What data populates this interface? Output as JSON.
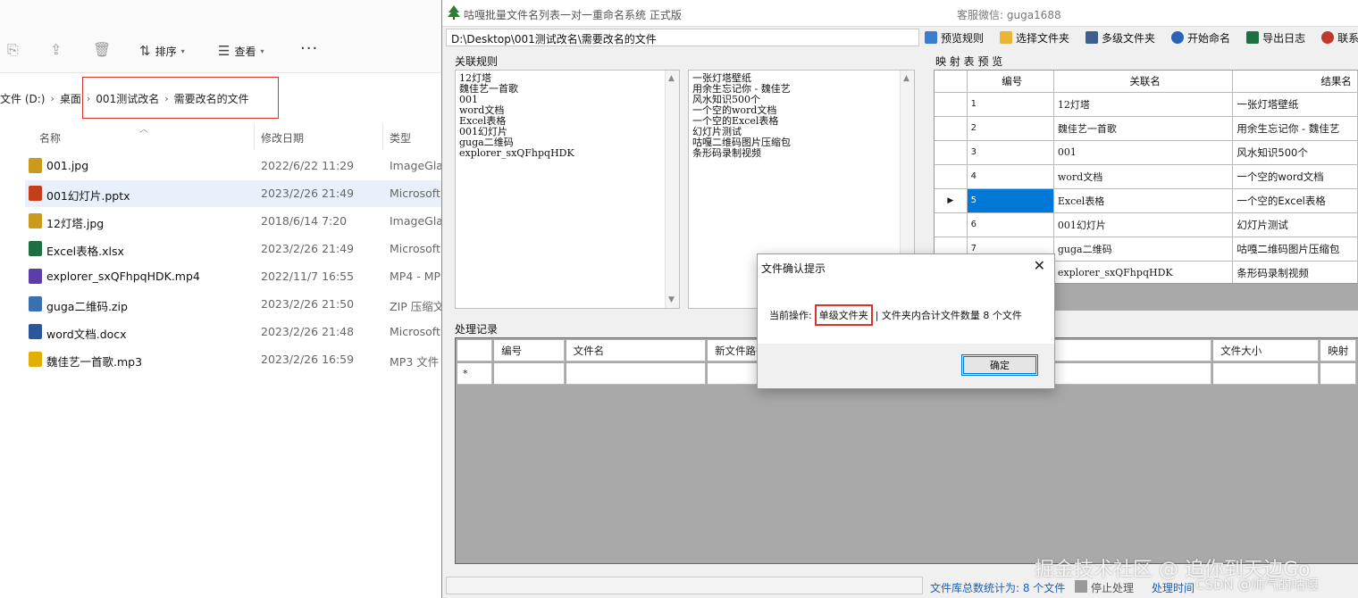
{
  "explorer": {
    "toolbar": {
      "sort_label": "排序",
      "view_label": "查看",
      "more_label": "···"
    },
    "breadcrumbs": [
      "文件 (D:)",
      "桌面",
      "001测试改名",
      "需要改名的文件"
    ],
    "columns": {
      "name": "名称",
      "date": "修改日期",
      "type": "类型"
    },
    "files": [
      {
        "name": "001.jpg",
        "date": "2022/6/22 11:29",
        "type": "ImageGlas",
        "icon": "jpg-icon",
        "color": "#c99a1c"
      },
      {
        "name": "001幻灯片.pptx",
        "date": "2023/2/26 21:49",
        "type": "Microsoft",
        "icon": "pptx-icon",
        "color": "#c43e1c"
      },
      {
        "name": "12灯塔.jpg",
        "date": "2018/6/14 7:20",
        "type": "ImageGlas",
        "icon": "jpg-icon",
        "color": "#c99a1c"
      },
      {
        "name": "Excel表格.xlsx",
        "date": "2023/2/26 21:49",
        "type": "Microsoft",
        "icon": "xlsx-icon",
        "color": "#1d6f42"
      },
      {
        "name": "explorer_sxQFhpqHDK.mp4",
        "date": "2022/11/7 16:55",
        "type": "MP4 - MP",
        "icon": "mp4-icon",
        "color": "#5b3ea8"
      },
      {
        "name": "guga二维码.zip",
        "date": "2023/2/26 21:50",
        "type": "ZIP 压缩文",
        "icon": "zip-icon",
        "color": "#3a6fb0"
      },
      {
        "name": "word文档.docx",
        "date": "2023/2/26 21:48",
        "type": "Microsoft",
        "icon": "docx-icon",
        "color": "#2b579a"
      },
      {
        "name": "魏佳艺一首歌.mp3",
        "date": "2023/2/26 16:59",
        "type": "MP3 文件",
        "icon": "mp3-icon",
        "color": "#e0b000"
      }
    ]
  },
  "app": {
    "title": "咕嘎批量文件名列表一对一重命名系统  正式版",
    "support": "客服微信: guga1688",
    "path": "D:\\Desktop\\001测试改名\\需要改名的文件",
    "tools": [
      {
        "label": "预览规则",
        "icon": "preview-icon",
        "color": "#3c7bd0"
      },
      {
        "label": "选择文件夹",
        "icon": "folder-icon",
        "color": "#e8b534"
      },
      {
        "label": "多级文件夹",
        "icon": "multi-folder-icon",
        "color": "#3d5f8f"
      },
      {
        "label": "开始命名",
        "icon": "start-icon",
        "color": "#2a64b8"
      },
      {
        "label": "导出日志",
        "icon": "excel-icon",
        "color": "#1d7044"
      },
      {
        "label": "联系",
        "icon": "contact-icon",
        "color": "#c0392b"
      }
    ],
    "rules_label": "关联规则",
    "rules_left": [
      "12灯塔",
      "魏佳艺一首歌",
      "001",
      "word文档",
      "Excel表格",
      "001幻灯片",
      "guga二维码",
      "explorer_sxQFhpqHDK"
    ],
    "rules_right": [
      "一张灯塔壁纸",
      "用余生忘记你 - 魏佳艺",
      "风水知识500个",
      "一个空的word文档",
      "一个空的Excel表格",
      "幻灯片测试",
      "咕嘎二维码图片压缩包",
      "条形码录制视频"
    ],
    "map_label": "映 射 表 预 览",
    "map_headers": [
      "编号",
      "关联名",
      "结果名"
    ],
    "map_rows": [
      {
        "id": "1",
        "name": "12灯塔",
        "result": "一张灯塔壁纸"
      },
      {
        "id": "2",
        "name": "魏佳艺一首歌",
        "result": "用余生忘记你 - 魏佳艺"
      },
      {
        "id": "3",
        "name": "001",
        "result": "风水知识500个"
      },
      {
        "id": "4",
        "name": "word文档",
        "result": "一个空的word文档"
      },
      {
        "id": "5",
        "name": "Excel表格",
        "result": "一个空的Excel表格"
      },
      {
        "id": "6",
        "name": "001幻灯片",
        "result": "幻灯片测试"
      },
      {
        "id": "7",
        "name": "guga二维码",
        "result": "咕嘎二维码图片压缩包"
      },
      {
        "id": "8",
        "name": "explorer_sxQFhpqHDK",
        "result": "条形码录制视频"
      }
    ],
    "selected_row_marker": "▶",
    "records_label": "处理记录",
    "record_headers": [
      "编号",
      "文件名",
      "新文件路径",
      "",
      "文件大小",
      "映射"
    ],
    "new_row_marker": "*",
    "status": {
      "total": "文件库总数统计为: 8 个文件",
      "stop": "停止处理",
      "time": "处理时间"
    }
  },
  "dialog": {
    "title": "文件确认提示",
    "close": "✕",
    "op_label": "当前操作:",
    "op_value": "单级文件夹",
    "op_detail": "| 文件夹内合计文件数量 8 个文件",
    "ok": "确定"
  },
  "watermark": {
    "main": "掘金技术社区 @ 追你到天边Go",
    "sub": "CSDN @帅气的咕嘎"
  }
}
